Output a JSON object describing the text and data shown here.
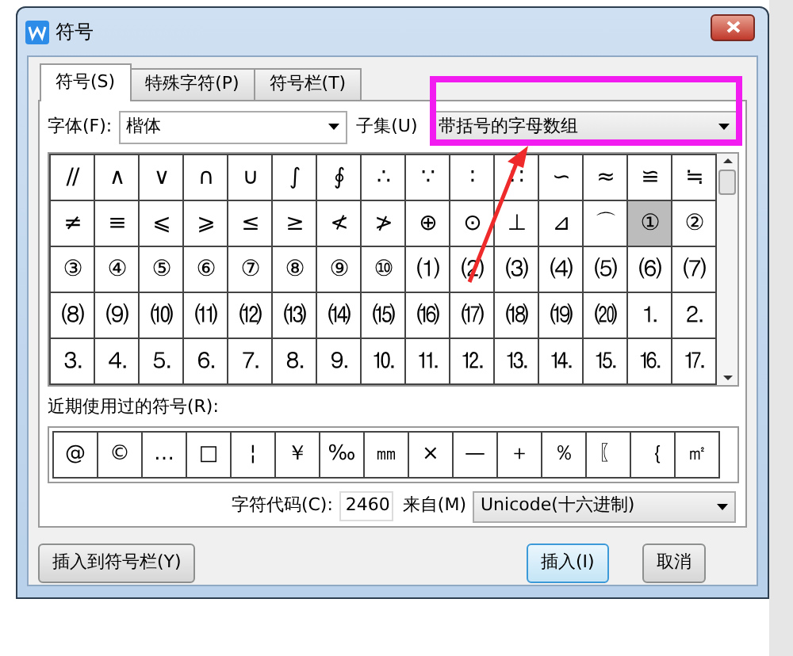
{
  "window": {
    "title": "符号"
  },
  "tabs": [
    {
      "label": "符号(S)",
      "selected": true
    },
    {
      "label": "特殊字符(P)",
      "selected": false
    },
    {
      "label": "符号栏(T)",
      "selected": false
    }
  ],
  "font": {
    "label": "字体(F):",
    "value": "楷体"
  },
  "subset": {
    "label": "子集(U)",
    "value": "带括号的字母数组"
  },
  "symbols": [
    {
      "symbol": "//",
      "selected": false
    },
    {
      "symbol": "∧",
      "selected": false
    },
    {
      "symbol": "∨",
      "selected": false
    },
    {
      "symbol": "∩",
      "selected": false
    },
    {
      "symbol": "∪",
      "selected": false
    },
    {
      "symbol": "∫",
      "selected": false
    },
    {
      "symbol": "∮",
      "selected": false
    },
    {
      "symbol": "∴",
      "selected": false
    },
    {
      "symbol": "∵",
      "selected": false
    },
    {
      "symbol": "∶",
      "selected": false
    },
    {
      "symbol": "∷",
      "selected": false
    },
    {
      "symbol": "∽",
      "selected": false
    },
    {
      "symbol": "≈",
      "selected": false
    },
    {
      "symbol": "≌",
      "selected": false
    },
    {
      "symbol": "≒",
      "selected": false
    },
    {
      "symbol": "≠",
      "selected": false
    },
    {
      "symbol": "≡",
      "selected": false
    },
    {
      "symbol": "⩽",
      "selected": false
    },
    {
      "symbol": "⩾",
      "selected": false
    },
    {
      "symbol": "≤",
      "selected": false
    },
    {
      "symbol": "≥",
      "selected": false
    },
    {
      "symbol": "≮",
      "selected": false
    },
    {
      "symbol": "≯",
      "selected": false
    },
    {
      "symbol": "⊕",
      "selected": false
    },
    {
      "symbol": "⊙",
      "selected": false
    },
    {
      "symbol": "⊥",
      "selected": false
    },
    {
      "symbol": "⊿",
      "selected": false
    },
    {
      "symbol": "⌒",
      "selected": false
    },
    {
      "symbol": "①",
      "selected": true
    },
    {
      "symbol": "②",
      "selected": false
    },
    {
      "symbol": "③",
      "selected": false
    },
    {
      "symbol": "④",
      "selected": false
    },
    {
      "symbol": "⑤",
      "selected": false
    },
    {
      "symbol": "⑥",
      "selected": false
    },
    {
      "symbol": "⑦",
      "selected": false
    },
    {
      "symbol": "⑧",
      "selected": false
    },
    {
      "symbol": "⑨",
      "selected": false
    },
    {
      "symbol": "⑩",
      "selected": false
    },
    {
      "symbol": "⑴",
      "selected": false
    },
    {
      "symbol": "⑵",
      "selected": false
    },
    {
      "symbol": "⑶",
      "selected": false
    },
    {
      "symbol": "⑷",
      "selected": false
    },
    {
      "symbol": "⑸",
      "selected": false
    },
    {
      "symbol": "⑹",
      "selected": false
    },
    {
      "symbol": "⑺",
      "selected": false
    },
    {
      "symbol": "⑻",
      "selected": false
    },
    {
      "symbol": "⑼",
      "selected": false
    },
    {
      "symbol": "⑽",
      "selected": false
    },
    {
      "symbol": "⑾",
      "selected": false
    },
    {
      "symbol": "⑿",
      "selected": false
    },
    {
      "symbol": "⒀",
      "selected": false
    },
    {
      "symbol": "⒁",
      "selected": false
    },
    {
      "symbol": "⒂",
      "selected": false
    },
    {
      "symbol": "⒃",
      "selected": false
    },
    {
      "symbol": "⒄",
      "selected": false
    },
    {
      "symbol": "⒅",
      "selected": false
    },
    {
      "symbol": "⒆",
      "selected": false
    },
    {
      "symbol": "⒇",
      "selected": false
    },
    {
      "symbol": "⒈",
      "selected": false
    },
    {
      "symbol": "⒉",
      "selected": false
    },
    {
      "symbol": "⒊",
      "selected": false
    },
    {
      "symbol": "⒋",
      "selected": false
    },
    {
      "symbol": "⒌",
      "selected": false
    },
    {
      "symbol": "⒍",
      "selected": false
    },
    {
      "symbol": "⒎",
      "selected": false
    },
    {
      "symbol": "⒏",
      "selected": false
    },
    {
      "symbol": "⒐",
      "selected": false
    },
    {
      "symbol": "⒑",
      "selected": false
    },
    {
      "symbol": "⒒",
      "selected": false
    },
    {
      "symbol": "⒓",
      "selected": false
    },
    {
      "symbol": "⒔",
      "selected": false
    },
    {
      "symbol": "⒕",
      "selected": false
    },
    {
      "symbol": "⒖",
      "selected": false
    },
    {
      "symbol": "⒗",
      "selected": false
    },
    {
      "symbol": "⒘",
      "selected": false
    }
  ],
  "recent": {
    "label": "近期使用过的符号(R):",
    "symbols": [
      "@",
      "©",
      "…",
      "□",
      "¦",
      "￥",
      "‰",
      "㎜",
      "×",
      "—",
      "＋",
      "％",
      "〖",
      "｛",
      "㎡"
    ]
  },
  "char_code": {
    "label": "字符代码(C):",
    "value": "2460"
  },
  "from": {
    "label": "来自(M)",
    "value": "Unicode(十六进制)"
  },
  "buttons": [
    {
      "label": "插入到符号栏(Y)",
      "kind": "secondary"
    },
    {
      "label": "插入(I)",
      "kind": "default"
    },
    {
      "label": "取消",
      "kind": "secondary"
    }
  ]
}
